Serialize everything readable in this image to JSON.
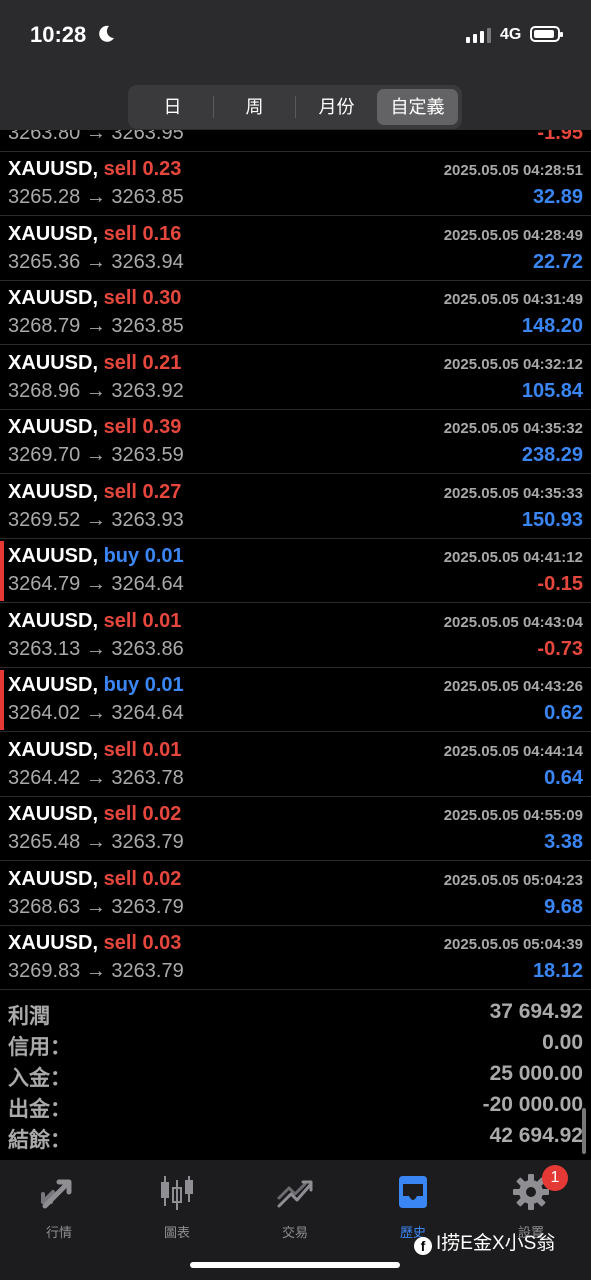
{
  "status": {
    "time": "10:28",
    "network": "4G"
  },
  "tabs": [
    {
      "label": "日",
      "selected": false
    },
    {
      "label": "周",
      "selected": false
    },
    {
      "label": "月份",
      "selected": false
    },
    {
      "label": "自定義",
      "selected": true
    }
  ],
  "trades": [
    {
      "symbol": "XAUUSD,",
      "side": "sell",
      "lots": "0.23",
      "prices": "3265.28 → 3263.85",
      "time": "2025.05.05 04:28:51",
      "profit": "32.89",
      "profit_sign": "pos",
      "flag": false
    },
    {
      "symbol": "XAUUSD,",
      "side": "sell",
      "lots": "0.16",
      "prices": "3265.36 → 3263.94",
      "time": "2025.05.05 04:28:49",
      "profit": "22.72",
      "profit_sign": "pos",
      "flag": false
    },
    {
      "symbol": "XAUUSD,",
      "side": "sell",
      "lots": "0.30",
      "prices": "3268.79 → 3263.85",
      "time": "2025.05.05 04:31:49",
      "profit": "148.20",
      "profit_sign": "pos",
      "flag": false
    },
    {
      "symbol": "XAUUSD,",
      "side": "sell",
      "lots": "0.21",
      "prices": "3268.96 → 3263.92",
      "time": "2025.05.05 04:32:12",
      "profit": "105.84",
      "profit_sign": "pos",
      "flag": false
    },
    {
      "symbol": "XAUUSD,",
      "side": "sell",
      "lots": "0.39",
      "prices": "3269.70 → 3263.59",
      "time": "2025.05.05 04:35:32",
      "profit": "238.29",
      "profit_sign": "pos",
      "flag": false
    },
    {
      "symbol": "XAUUSD,",
      "side": "sell",
      "lots": "0.27",
      "prices": "3269.52 → 3263.93",
      "time": "2025.05.05 04:35:33",
      "profit": "150.93",
      "profit_sign": "pos",
      "flag": false
    },
    {
      "symbol": "XAUUSD,",
      "side": "buy",
      "lots": "0.01",
      "prices": "3264.79 → 3264.64",
      "time": "2025.05.05 04:41:12",
      "profit": "-0.15",
      "profit_sign": "neg",
      "flag": true
    },
    {
      "symbol": "XAUUSD,",
      "side": "sell",
      "lots": "0.01",
      "prices": "3263.13 → 3263.86",
      "time": "2025.05.05 04:43:04",
      "profit": "-0.73",
      "profit_sign": "neg",
      "flag": false
    },
    {
      "symbol": "XAUUSD,",
      "side": "buy",
      "lots": "0.01",
      "prices": "3264.02 → 3264.64",
      "time": "2025.05.05 04:43:26",
      "profit": "0.62",
      "profit_sign": "pos",
      "flag": true
    },
    {
      "symbol": "XAUUSD,",
      "side": "sell",
      "lots": "0.01",
      "prices": "3264.42 → 3263.78",
      "time": "2025.05.05 04:44:14",
      "profit": "0.64",
      "profit_sign": "pos",
      "flag": false
    },
    {
      "symbol": "XAUUSD,",
      "side": "sell",
      "lots": "0.02",
      "prices": "3265.48 → 3263.79",
      "time": "2025.05.05 04:55:09",
      "profit": "3.38",
      "profit_sign": "pos",
      "flag": false
    },
    {
      "symbol": "XAUUSD,",
      "side": "sell",
      "lots": "0.02",
      "prices": "3268.63 → 3263.79",
      "time": "2025.05.05 05:04:23",
      "profit": "9.68",
      "profit_sign": "pos",
      "flag": false
    },
    {
      "symbol": "XAUUSD,",
      "side": "sell",
      "lots": "0.03",
      "prices": "3269.83 → 3263.79",
      "time": "2025.05.05 05:04:39",
      "profit": "18.12",
      "profit_sign": "pos",
      "flag": false
    }
  ],
  "partial_row": {
    "prices": "3263.80 → 3263.95",
    "profit": "-1.95"
  },
  "summary": [
    {
      "label": "利潤",
      "value": "37 694.92"
    },
    {
      "label": "信用：",
      "value": "0.00"
    },
    {
      "label": "入金：",
      "value": "25 000.00"
    },
    {
      "label": "出金：",
      "value": "-20 000.00"
    },
    {
      "label": "結餘：",
      "value": "42 694.92"
    }
  ],
  "nav": [
    {
      "label": "行情",
      "icon": "quotes-arrow-icon",
      "active": false
    },
    {
      "label": "圖表",
      "icon": "candlestick-chart-icon",
      "active": false
    },
    {
      "label": "交易",
      "icon": "trade-trend-icon",
      "active": false
    },
    {
      "label": "歷史",
      "icon": "history-inbox-icon",
      "active": true
    },
    {
      "label": "設置",
      "icon": "gear-icon",
      "active": false
    }
  ],
  "settings_badge": "1",
  "watermark": "I捞E金X小S翁",
  "colors": {
    "sell": "#e5473d",
    "buy": "#3b86f5",
    "negative": "#e5473d",
    "positive": "#3b86f5",
    "background": "#000000"
  }
}
